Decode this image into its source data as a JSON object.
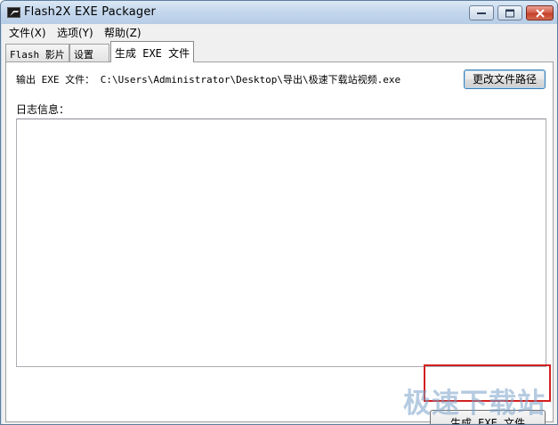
{
  "window": {
    "title": "Flash2X EXE Packager"
  },
  "menu": {
    "items": [
      {
        "label": "文件(X)"
      },
      {
        "label": "选项(Y)"
      },
      {
        "label": "帮助(Z)"
      }
    ]
  },
  "tabs": [
    {
      "label": "Flash 影片",
      "active": false
    },
    {
      "label": "设置",
      "active": false
    },
    {
      "label": "生成 EXE 文件",
      "active": true
    }
  ],
  "output": {
    "label": "输出 EXE 文件：",
    "path": "C:\\Users\\Administrator\\Desktop\\导出\\极速下载站视频.exe",
    "change_path_button": "更改文件路径"
  },
  "log": {
    "label": "日志信息：",
    "value": ""
  },
  "generate_button": "生成 EXE 文件",
  "watermark": "极速下载站",
  "colors": {
    "highlight_border": "#d32020"
  }
}
